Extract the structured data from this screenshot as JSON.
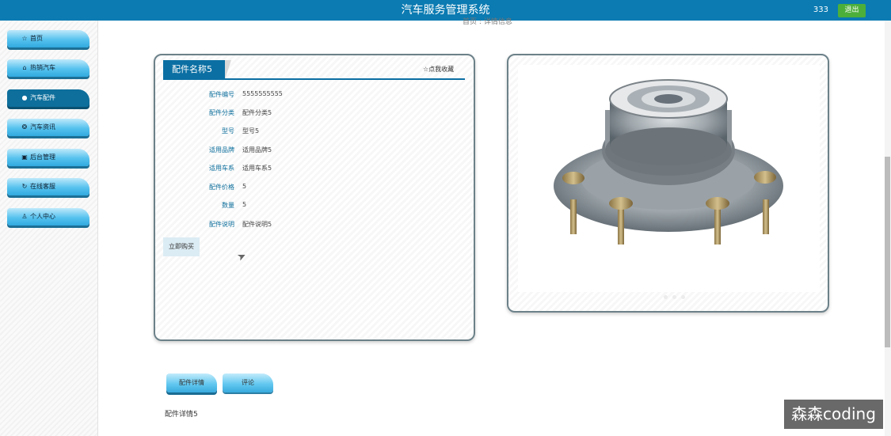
{
  "header": {
    "app_title": "汽车服务管理系统",
    "user": "333",
    "logout_label": "退出",
    "brand_color": "#0b7bb2"
  },
  "sidebar": {
    "items": [
      {
        "icon": "home-icon",
        "label": "首页",
        "active": false
      },
      {
        "icon": "car-icon",
        "label": "热销汽车",
        "active": false
      },
      {
        "icon": "parts-icon",
        "label": "汽车配件",
        "active": true
      },
      {
        "icon": "info-icon",
        "label": "汽车资讯",
        "active": false
      },
      {
        "icon": "admin-icon",
        "label": "后台管理",
        "active": false
      },
      {
        "icon": "support-icon",
        "label": "在线客服",
        "active": false
      },
      {
        "icon": "user-icon",
        "label": "个人中心",
        "active": false
      }
    ]
  },
  "breadcrumb": {
    "home": "首页",
    "separator": ":",
    "current": "详情信息"
  },
  "detail": {
    "name": "配件名称5",
    "favorite_label": "点我收藏",
    "fields": [
      {
        "label": "配件编号",
        "value": "5555555555"
      },
      {
        "label": "配件分类",
        "value": "配件分类5"
      },
      {
        "label": "型号",
        "value": "型号5"
      },
      {
        "label": "适用品牌",
        "value": "适用品牌5"
      },
      {
        "label": "适用车系",
        "value": "适用车系5"
      },
      {
        "label": "配件价格",
        "value": "5"
      },
      {
        "label": "数量",
        "value": "5"
      },
      {
        "label": "配件说明",
        "value": "配件说明5"
      }
    ],
    "buy_label": "立即购买"
  },
  "image_panel": {
    "image_name": "wheel-hub-bearing-image"
  },
  "tabs": [
    {
      "label": "配件详情",
      "active": true
    },
    {
      "label": "评论",
      "active": false
    }
  ],
  "tab_content": "配件详情5",
  "watermark": "森森coding"
}
